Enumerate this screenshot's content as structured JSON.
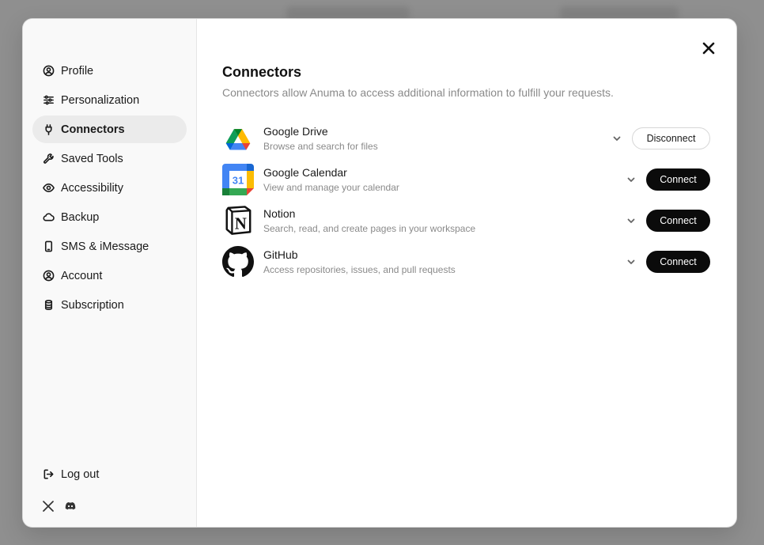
{
  "sidebar": {
    "items": [
      {
        "label": "Profile",
        "icon": "user-circle-icon",
        "active": false
      },
      {
        "label": "Personalization",
        "icon": "sliders-icon",
        "active": false
      },
      {
        "label": "Connectors",
        "icon": "plug-icon",
        "active": true
      },
      {
        "label": "Saved Tools",
        "icon": "wrench-icon",
        "active": false
      },
      {
        "label": "Accessibility",
        "icon": "eye-icon",
        "active": false
      },
      {
        "label": "Backup",
        "icon": "cloud-icon",
        "active": false
      },
      {
        "label": "SMS & iMessage",
        "icon": "phone-icon",
        "active": false
      },
      {
        "label": "Account",
        "icon": "account-icon",
        "active": false
      },
      {
        "label": "Subscription",
        "icon": "database-icon",
        "active": false
      }
    ],
    "logout_label": "Log out",
    "social": [
      "x-icon",
      "discord-icon"
    ]
  },
  "main": {
    "title": "Connectors",
    "subtitle": "Connectors allow Anuma to access additional information to fulfill your requests.",
    "connectors": [
      {
        "name": "Google Drive",
        "description": "Browse and search for files",
        "button": "Disconnect",
        "connected": true,
        "icon": "google-drive-icon"
      },
      {
        "name": "Google Calendar",
        "description": "View and manage your calendar",
        "button": "Connect",
        "connected": false,
        "icon": "google-calendar-icon",
        "icon_text": "31"
      },
      {
        "name": "Notion",
        "description": "Search, read, and create pages in your workspace",
        "button": "Connect",
        "connected": false,
        "icon": "notion-icon",
        "icon_text": "N"
      },
      {
        "name": "GitHub",
        "description": "Access repositories, issues, and pull requests",
        "button": "Connect",
        "connected": false,
        "icon": "github-icon"
      }
    ]
  },
  "colors": {
    "overlay": "#8f8f8f",
    "active_nav": "#ebebeb",
    "connect_button": "#0b0b0b",
    "muted_text": "#8a8a8a"
  }
}
